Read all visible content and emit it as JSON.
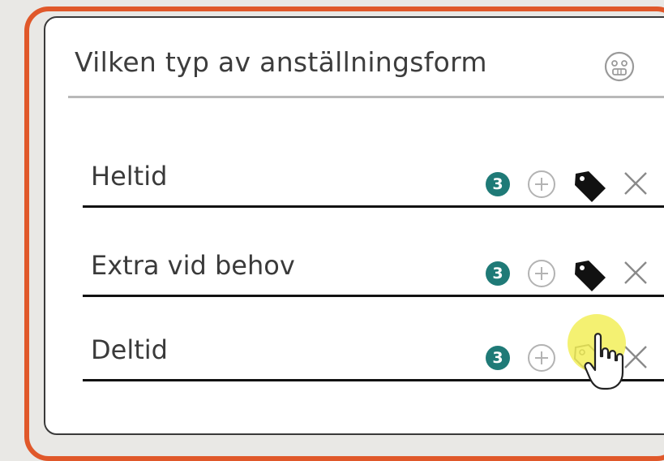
{
  "question": {
    "title": "Vilken typ av anställningsform",
    "emoji_icon": "smiley-face-icon"
  },
  "options": [
    {
      "label": "Heltid",
      "count": "3",
      "tag_state": "filled"
    },
    {
      "label": "Extra vid behov",
      "count": "3",
      "tag_state": "filled"
    },
    {
      "label": "Deltid",
      "count": "3",
      "tag_state": "outline-hovered"
    }
  ],
  "colors": {
    "highlight_frame": "#e0582a",
    "badge": "#1f7a77",
    "cursor_highlight": "#f0ec3c",
    "background": "#e9e8e5"
  },
  "icons": {
    "add": "plus-circle-icon",
    "tag": "tag-icon",
    "remove": "close-icon",
    "cursor": "hand-pointer-cursor"
  }
}
